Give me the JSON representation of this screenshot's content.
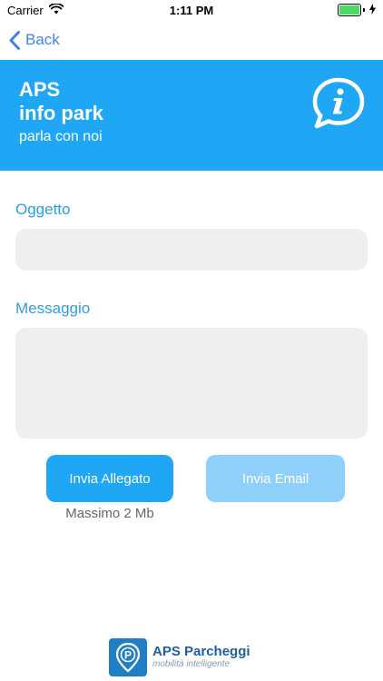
{
  "status_bar": {
    "carrier": "Carrier",
    "time": "1:11 PM",
    "battery_level": 1.0,
    "battery_color": "#4cd964",
    "icons": [
      "wifi-icon",
      "battery-icon",
      "charging-icon"
    ]
  },
  "nav": {
    "back_label": "Back",
    "back_icon": "chevron-left-icon",
    "tint_color": "#3d84e8"
  },
  "header": {
    "title_line1": "APS",
    "title_line2": "info park",
    "subtitle": "parla con noi",
    "icon": "info-chat-icon",
    "background_color": "#1fa6f5"
  },
  "form": {
    "subject_label": "Oggetto",
    "subject_value": "",
    "message_label": "Messaggio",
    "message_value": "",
    "label_color": "#2b9ee0"
  },
  "actions": {
    "attach_label": "Invia Allegato",
    "attach_note": "Massimo 2 Mb",
    "email_label": "Invia Email",
    "attach_color": "#1fa6f5",
    "email_color": "#8fd0fa"
  },
  "footer": {
    "logo_name": "APS Parcheggi",
    "logo_tagline": "mobilità intelligente",
    "logo_icon": "parking-pin-icon"
  }
}
